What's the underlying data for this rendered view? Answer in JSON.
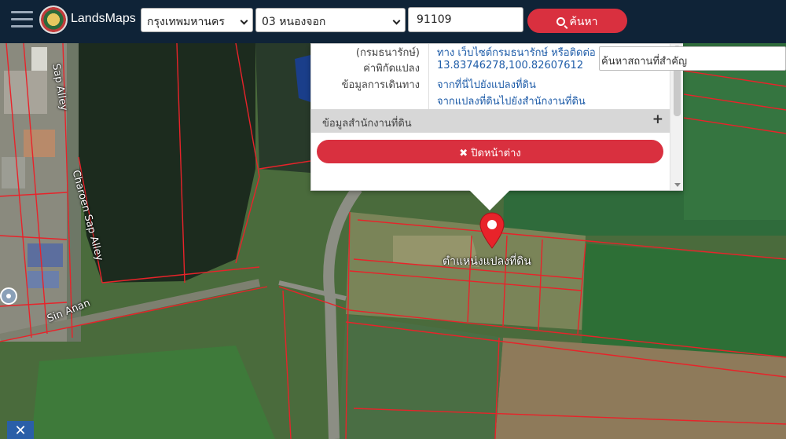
{
  "app": {
    "brand": "LandsMaps"
  },
  "search": {
    "province": "กรุงเทพมหานคร",
    "district": "03 หนองจอก",
    "parcel_no": "91109",
    "button_label": "ค้นหา"
  },
  "landmark_search": {
    "placeholder": "ค้นหาสถานที่สำคัญ"
  },
  "popup": {
    "rows": [
      {
        "label": "(กรมธนารักษ์)",
        "value": "ทาง เว็บไซต์กรมธนารักษ์ หรือติดต่อ"
      },
      {
        "label": "ค่าพิกัดแปลง",
        "value": "13.83746278,100.82607612"
      },
      {
        "label": "ข้อมูลการเดินทาง",
        "value": "จากที่นี่ไปยังแปลงที่ดิน"
      },
      {
        "label": "",
        "value": "จากแปลงที่ดินไปยังสำนักงานที่ดิน"
      }
    ],
    "section_title": "ข้อมูลสำนักงานที่ดิน",
    "close_label": "ปิดหน้าต่าง"
  },
  "map": {
    "pin_label": "ตำแหน่งแปลงที่ดิน",
    "road_labels": [
      "Sap Alley",
      "Charoen Sap Alley",
      "Sin Anan"
    ]
  },
  "colors": {
    "navbar": "#0f2337",
    "accent": "#d9303f",
    "link": "#1e5ca8",
    "parcel_line": "#e8232a"
  }
}
